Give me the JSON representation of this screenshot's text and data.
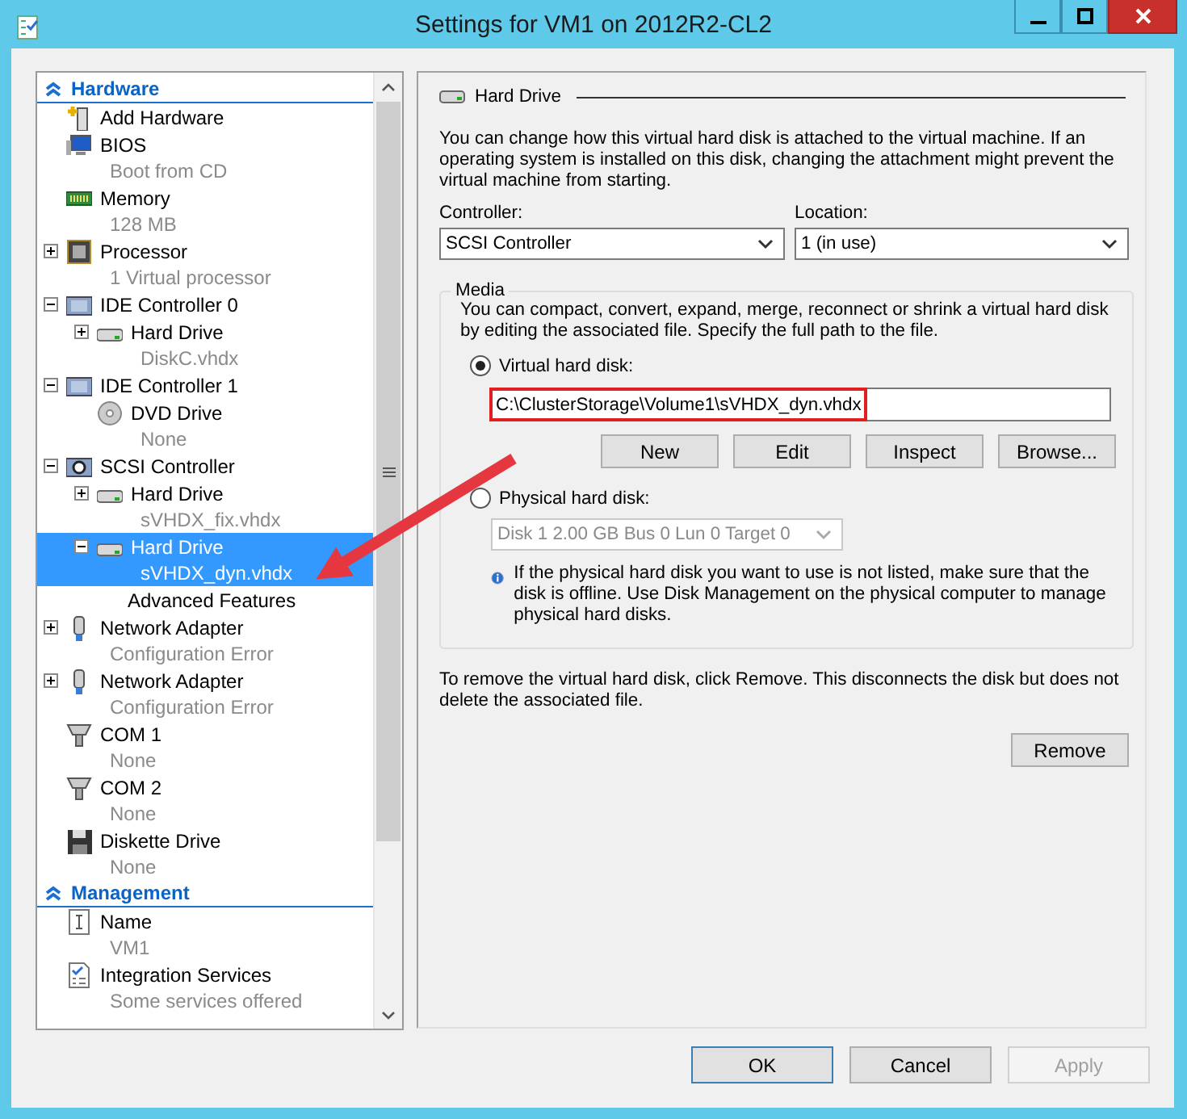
{
  "window": {
    "title": "Settings for VM1 on 2012R2-CL2"
  },
  "sidebar": {
    "sections": [
      {
        "label": "Hardware",
        "expanded": true,
        "items": [
          {
            "label": "Add Hardware",
            "kind": "add-hardware",
            "selected": false
          },
          {
            "label": "BIOS",
            "detail": "Boot from CD",
            "kind": "bios",
            "selected": false
          },
          {
            "label": "Memory",
            "detail": "128 MB",
            "kind": "memory",
            "selected": false
          },
          {
            "label": "Processor",
            "detail": "1 Virtual processor",
            "kind": "processor",
            "expanded": false,
            "selected": false
          },
          {
            "label": "IDE Controller 0",
            "kind": "controller",
            "expanded": true,
            "selected": false,
            "children": [
              {
                "label": "Hard Drive",
                "detail": "DiskC.vhdx",
                "kind": "hard-drive",
                "expanded": false,
                "selected": false
              }
            ]
          },
          {
            "label": "IDE Controller 1",
            "kind": "controller",
            "expanded": true,
            "selected": false,
            "children": [
              {
                "label": "DVD Drive",
                "detail": "None",
                "kind": "dvd",
                "selected": false
              }
            ]
          },
          {
            "label": "SCSI Controller",
            "kind": "scsi",
            "expanded": true,
            "selected": false,
            "children": [
              {
                "label": "Hard Drive",
                "detail": "sVHDX_fix.vhdx",
                "kind": "hard-drive",
                "expanded": false,
                "selected": false
              },
              {
                "label": "Hard Drive",
                "detail": "sVHDX_dyn.vhdx",
                "kind": "hard-drive",
                "expanded": true,
                "selected": true,
                "children": [
                  {
                    "label": "Advanced Features",
                    "selected": false
                  }
                ]
              }
            ]
          },
          {
            "label": "Network Adapter",
            "detail": "Configuration Error",
            "kind": "network",
            "expanded": false,
            "selected": false
          },
          {
            "label": "Network Adapter",
            "detail": "Configuration Error",
            "kind": "network",
            "expanded": false,
            "selected": false
          },
          {
            "label": "COM 1",
            "detail": "None",
            "kind": "com",
            "selected": false
          },
          {
            "label": "COM 2",
            "detail": "None",
            "kind": "com",
            "selected": false
          },
          {
            "label": "Diskette Drive",
            "detail": "None",
            "kind": "diskette",
            "selected": false
          }
        ]
      },
      {
        "label": "Management",
        "expanded": true,
        "items": [
          {
            "label": "Name",
            "detail": "VM1",
            "kind": "name",
            "selected": false
          },
          {
            "label": "Integration Services",
            "detail": "Some services offered",
            "kind": "integration",
            "selected": false
          }
        ]
      }
    ]
  },
  "hard_drive": {
    "title": "Hard Drive",
    "description": "You can change how this virtual hard disk is attached to the virtual machine. If an operating system is installed on this disk, changing the attachment might prevent the virtual machine from starting.",
    "controller": {
      "label": "Controller:",
      "value": "SCSI Controller"
    },
    "location": {
      "label": "Location:",
      "value": "1 (in use)"
    },
    "media": {
      "title": "Media",
      "description": "You can compact, convert, expand, merge, reconnect or shrink a virtual hard disk by editing the associated file. Specify the full path to the file.",
      "options": [
        {
          "label": "Virtual hard disk:",
          "selected": true
        },
        {
          "label": "Physical hard disk:",
          "selected": false
        }
      ],
      "path": "C:\\ClusterStorage\\Volume1\\sVHDX_dyn.vhdx",
      "buttons": [
        "New",
        "Edit",
        "Inspect",
        "Browse..."
      ],
      "disk": {
        "value": "Disk 1 2.00 GB Bus 0 Lun 0 Target 0",
        "disabled": true
      },
      "info": "If the physical hard disk you want to use is not listed, make sure that the disk is offline. Use Disk Management on the physical computer to manage physical hard disks."
    },
    "remove_text": "To remove the virtual hard disk, click Remove. This disconnects the disk but does not delete the associated file.",
    "remove_button": "Remove"
  },
  "buttons": [
    {
      "label": "OK",
      "default": true,
      "disabled": false
    },
    {
      "label": "Cancel",
      "default": false,
      "disabled": false
    },
    {
      "label": "Apply",
      "default": false,
      "disabled": true
    }
  ]
}
